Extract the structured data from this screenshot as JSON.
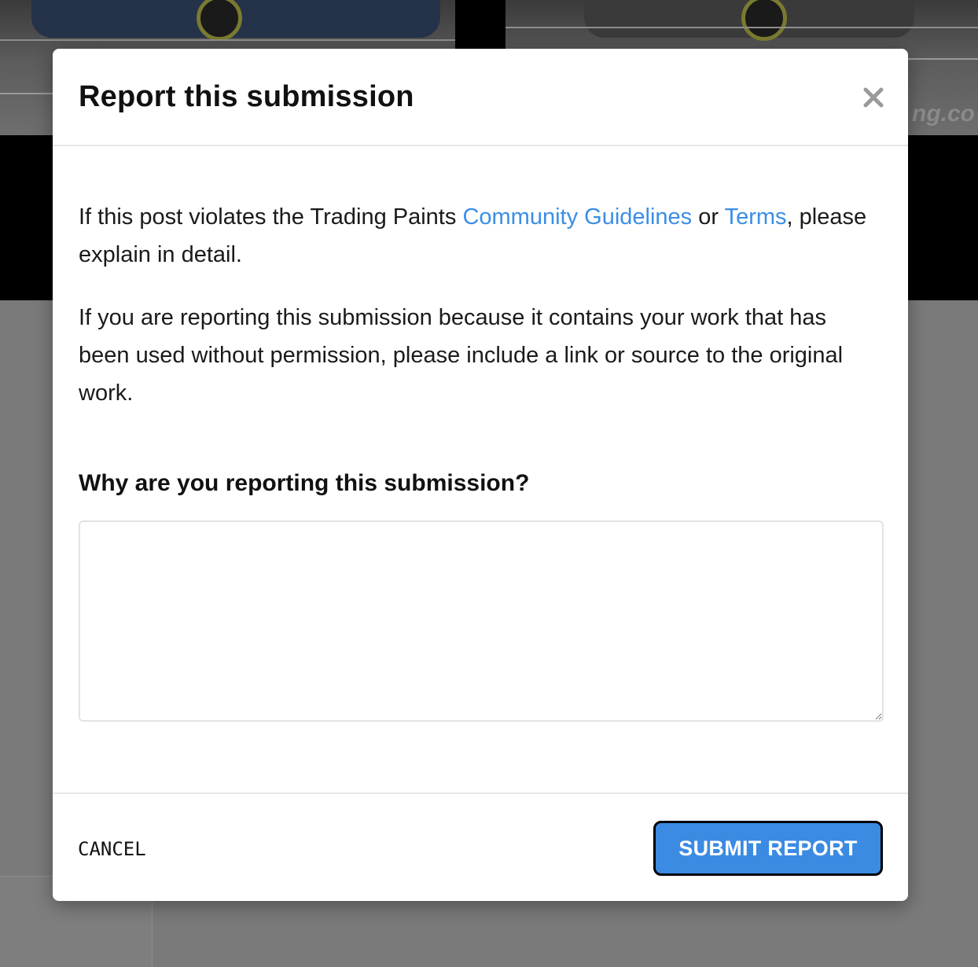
{
  "modal": {
    "title": "Report this submission",
    "close_icon": "close-icon",
    "intro_before": "If this post violates the Trading Paints ",
    "guidelines_link": "Community Guidelines",
    "intro_or": " or ",
    "terms_link": "Terms",
    "intro_after": ", please explain in detail.",
    "copyright_note": "If you are reporting this submission because it contains your work that has been used without permission, please include a link or source to the original work.",
    "question": "Why are you reporting this submission?",
    "textarea_value": "",
    "textarea_placeholder": ""
  },
  "footer": {
    "cancel_label": "CANCEL",
    "submit_label": "SUBMIT REPORT"
  },
  "background": {
    "watermark": "ng.co"
  },
  "colors": {
    "link": "#3a8ee6",
    "submit_bg": "#3b8be3",
    "overlay": "#7a7a7a"
  }
}
